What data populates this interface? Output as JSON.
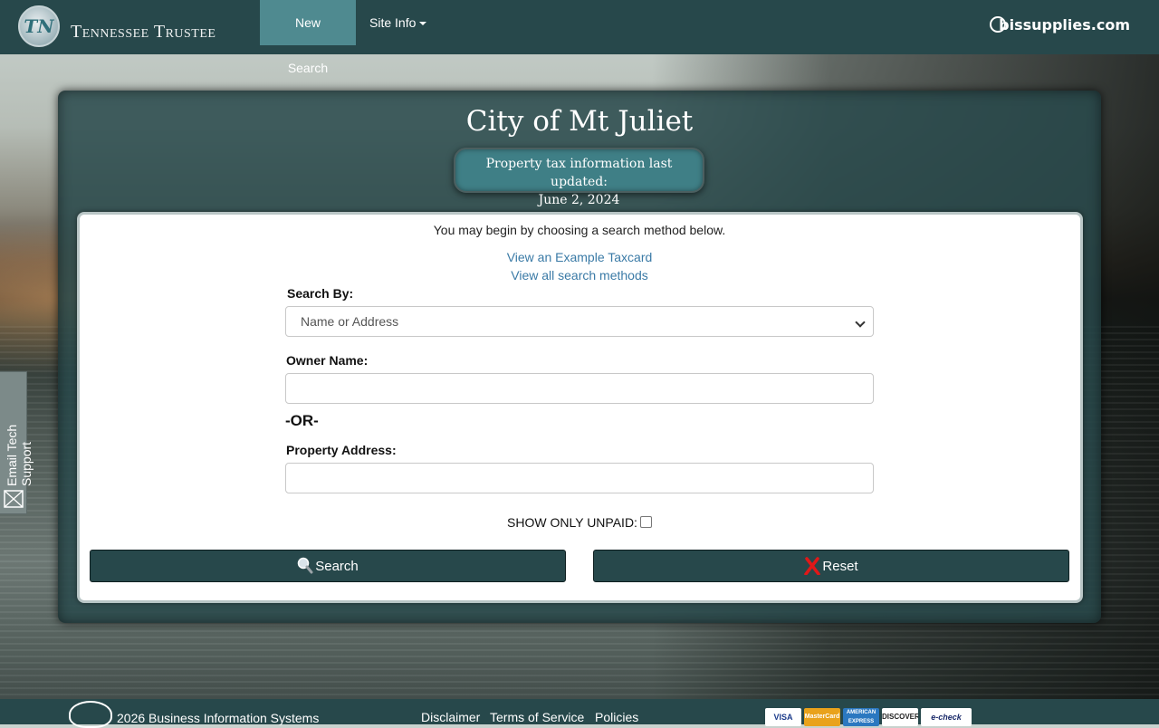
{
  "navbar": {
    "logo_text": "TN",
    "brand": "Tennessee Trustee",
    "nav_new_search": "New Search",
    "nav_site_info": "Site Info",
    "right_logo_text": "bissupplies.com"
  },
  "side_tab": {
    "label": "Email Tech Support"
  },
  "header": {
    "city": "City of Mt Juliet",
    "updated_line1": "Property tax information last updated:",
    "updated_line2": "June 2, 2024"
  },
  "form": {
    "intro": "You may begin by choosing a search method below.",
    "link_example": "View an Example Taxcard",
    "link_all": "View all search methods",
    "search_by_label": "Search By:",
    "search_by_value": "Name or Address",
    "owner_label": "Owner Name:",
    "owner_value": "",
    "or_text": "-OR-",
    "address_label": "Property Address:",
    "address_value": "",
    "unpaid_label": "SHOW ONLY UNPAID:",
    "unpaid_checked": false,
    "search_button": "Search",
    "reset_button": "Reset"
  },
  "footer": {
    "copyright": "2026 Business Information Systems",
    "links": [
      "Disclaimer",
      "Terms of Service",
      "Policies"
    ],
    "payment_cards": [
      "VISA",
      "MasterCard",
      "AMERICAN EXPRESS",
      "DISCOVER",
      "e-check"
    ]
  },
  "colors": {
    "navbar": "#27484b",
    "nav_active": "#4f8a90",
    "link": "#3a7aa6",
    "button": "#27484b",
    "updated_pill": "#3f7f86"
  }
}
